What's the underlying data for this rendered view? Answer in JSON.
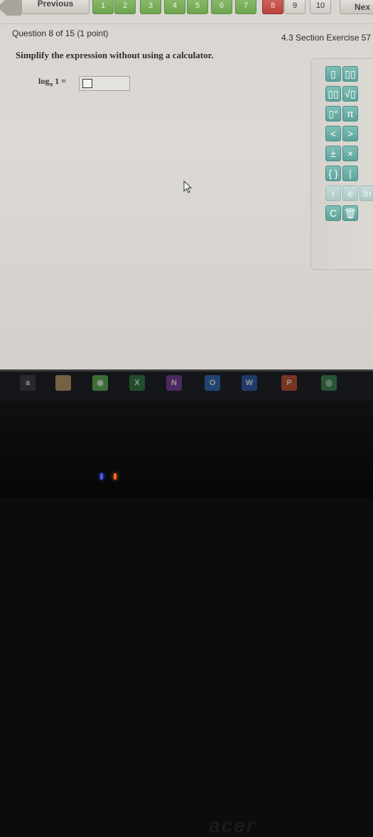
{
  "nav": {
    "previous_label": "Previous",
    "next_label": "Nex",
    "questions": [
      {
        "num": "1",
        "state": "done"
      },
      {
        "num": "2",
        "state": "done"
      },
      {
        "num": "3",
        "state": "done"
      },
      {
        "num": "4",
        "state": "done"
      },
      {
        "num": "5",
        "state": "done"
      },
      {
        "num": "6",
        "state": "done"
      },
      {
        "num": "7",
        "state": "done"
      },
      {
        "num": "8",
        "state": "current"
      },
      {
        "num": "9",
        "state": "todo"
      },
      {
        "num": "10",
        "state": "todo"
      }
    ]
  },
  "question": {
    "title": "Question 8 of 15 (1 point)",
    "section": "4.3 Section Exercise 57",
    "instruction": "Simplify the expression without using a calculator.",
    "expr_log": "log",
    "expr_base": "π",
    "expr_rest": "1 ="
  },
  "palette": {
    "keys": [
      {
        "label": "▯",
        "name": "fraction-key"
      },
      {
        "label": "▯▯",
        "name": "mixed-number-key"
      },
      {
        "label": "▯▯",
        "name": "exponent-key"
      },
      {
        "label": "√▯",
        "name": "sqrt-key"
      },
      {
        "label": "▯°",
        "name": "degree-key"
      },
      {
        "label": "π",
        "name": "pi-key"
      },
      {
        "label": "<",
        "name": "less-than-key"
      },
      {
        "label": ">",
        "name": "greater-than-key"
      },
      {
        "label": "±",
        "name": "plus-minus-key"
      },
      {
        "label": "×",
        "name": "times-key"
      },
      {
        "label": "{ }",
        "name": "set-braces-key"
      },
      {
        "label": "|",
        "name": "absolute-key"
      },
      {
        "label": "i",
        "name": "imaginary-i-key"
      },
      {
        "label": "e",
        "name": "e-key"
      },
      {
        "label": "ln",
        "name": "ln-key"
      },
      {
        "label": "C",
        "name": "clear-key"
      },
      {
        "label": "🗑",
        "name": "trash-key"
      }
    ]
  },
  "taskbar": {
    "items": [
      {
        "label": "a",
        "name": "amazon-icon",
        "color": "#3a3a3a"
      },
      {
        "label": "",
        "name": "finder-icon",
        "color": "#c4a36a"
      },
      {
        "label": "◉",
        "name": "spotify-icon",
        "color": "#5cb84a"
      },
      {
        "label": "X",
        "name": "excel-icon",
        "color": "#2e7a3e"
      },
      {
        "label": "N",
        "name": "onenote-icon",
        "color": "#7a3a9a"
      },
      {
        "label": "O",
        "name": "outlook-icon",
        "color": "#2a6ab8"
      },
      {
        "label": "W",
        "name": "word-icon",
        "color": "#2a5aa8"
      },
      {
        "label": "P",
        "name": "powerpoint-icon",
        "color": "#c8502a"
      },
      {
        "label": "◎",
        "name": "chrome-icon",
        "color": "#3a8a4a"
      }
    ]
  },
  "bezel": {
    "brand": "acer"
  }
}
